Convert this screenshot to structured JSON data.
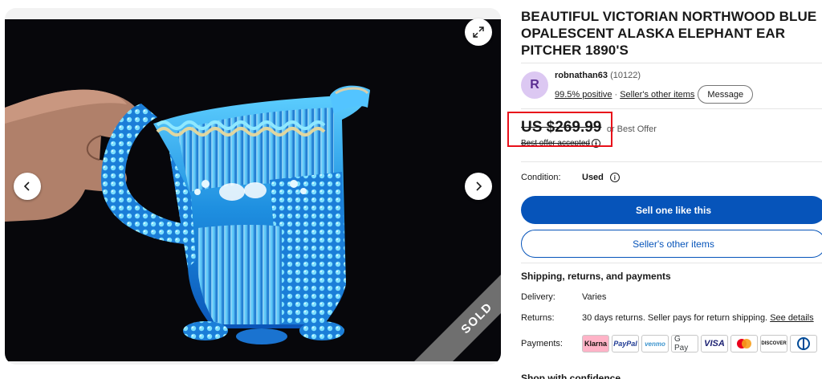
{
  "listing": {
    "title": "BEAUTIFUL VICTORIAN NORTHWOOD BLUE OPALESCENT ALASKA ELEPHANT EAR PITCHER 1890'S",
    "sold_label": "SOLD"
  },
  "seller": {
    "avatar_letter": "R",
    "name": "robnathan63",
    "feedback_count": "(10122)",
    "positive": "99.5% positive",
    "separator": "·",
    "other_items_link": "Seller's other items",
    "message_label": "Message"
  },
  "price": {
    "amount": "US $269.99",
    "best_offer": "or Best Offer",
    "offer_accepted": "Best offer accepted"
  },
  "condition": {
    "label": "Condition:",
    "value": "Used"
  },
  "actions": {
    "primary": "Sell one like this",
    "secondary": "Seller's other items"
  },
  "shipping": {
    "heading": "Shipping, returns, and payments",
    "delivery_label": "Delivery:",
    "delivery_value": "Varies",
    "returns_label": "Returns:",
    "returns_value": "30 days returns. Seller pays for return shipping.",
    "returns_link": "See details",
    "payments_label": "Payments:",
    "payment_methods": [
      "Klarna",
      "PayPal",
      "venmo",
      "G Pay",
      "VISA",
      "Mastercard",
      "DISCOVER",
      "Diners Club"
    ]
  },
  "footer_cut": "Shop with confidence",
  "colors": {
    "accent_blue": "#0654ba",
    "highlight_red": "#e8101a",
    "avatar_bg": "#dcc8f2"
  }
}
